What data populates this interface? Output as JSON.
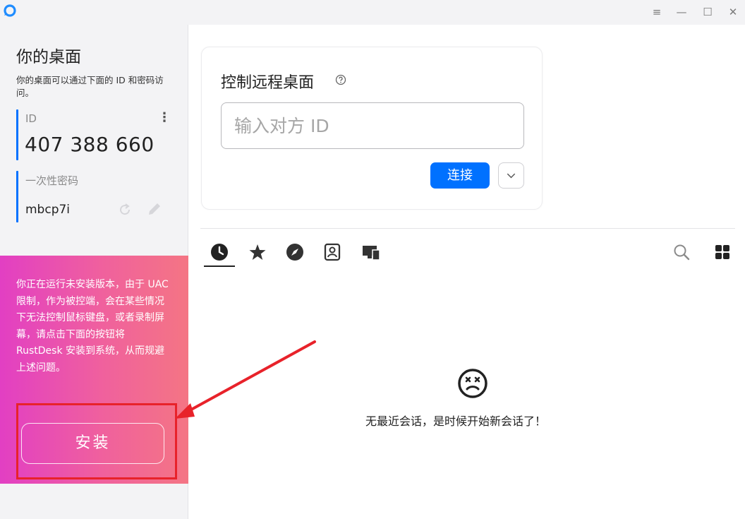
{
  "titlebar": {
    "icons": [
      "rustdesk-logo-icon",
      "menu-icon",
      "minimize-icon",
      "maximize-icon",
      "close-icon"
    ]
  },
  "sidebar": {
    "title": "你的桌面",
    "description": "你的桌面可以通过下面的 ID 和密码访问。",
    "id_label": "ID",
    "id_value": "407 388 660",
    "password_label": "一次性密码",
    "password_value": "mbcp7i"
  },
  "install": {
    "message": "你正在运行未安装版本，由于 UAC 限制，作为被控端，会在某些情况下无法控制鼠标键盘，或者录制屏幕，请点击下面的按钮将 RustDesk 安装到系统，从而规避上述问题。",
    "button_label": "安装"
  },
  "connect": {
    "title": "控制远程桌面",
    "input_placeholder": "输入对方 ID",
    "connect_label": "连接"
  },
  "tabs": {
    "items": [
      "recent-sessions-icon",
      "favorites-icon",
      "discovered-icon",
      "address-book-icon",
      "group-icon"
    ],
    "active": "recent-sessions-icon"
  },
  "empty_state": {
    "message": "无最近会话，是时候开始新会话了！"
  },
  "colors": {
    "accent": "#0071ff",
    "install_gradient_start": "#e23fc3",
    "install_gradient_end": "#f47584",
    "annotation": "#e8222a"
  }
}
